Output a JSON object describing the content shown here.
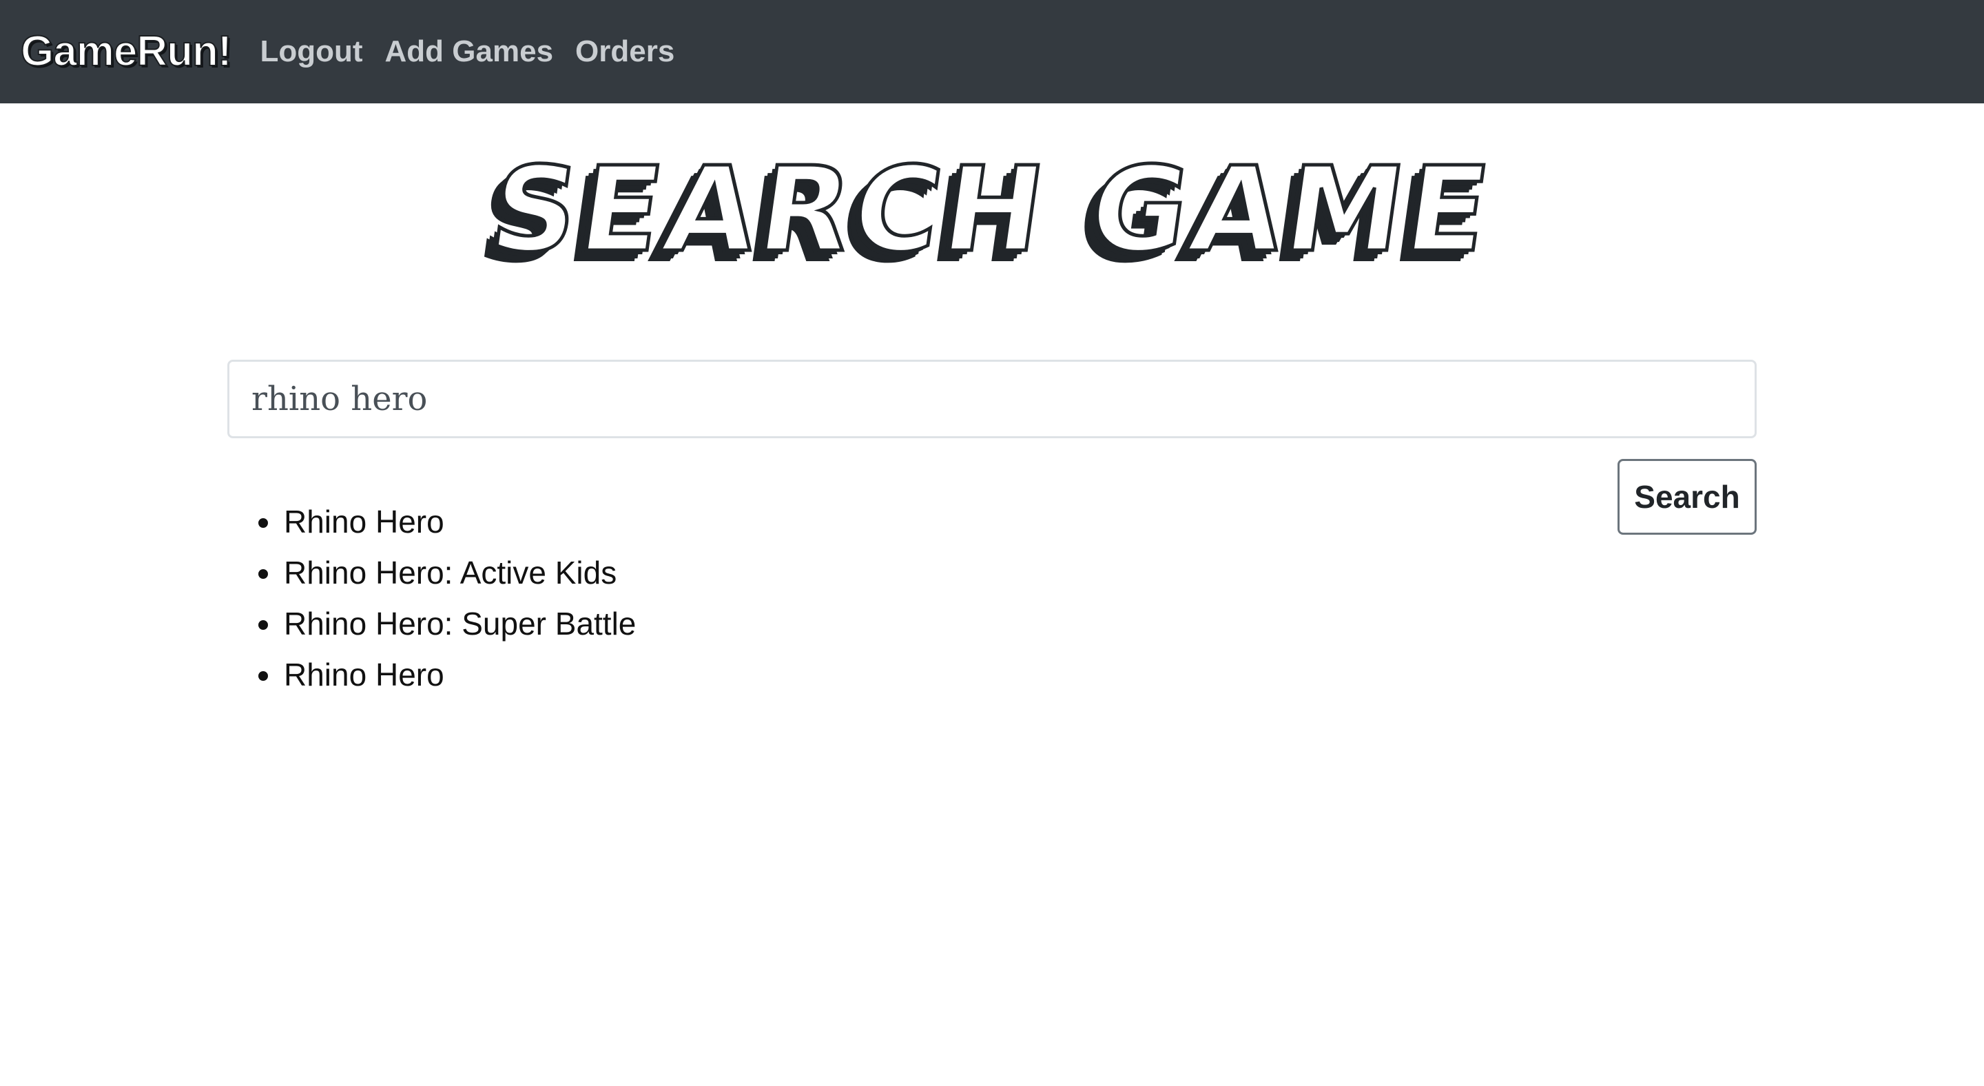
{
  "navbar": {
    "brand": "GameRun!",
    "links": [
      "Logout",
      "Add Games",
      "Orders"
    ]
  },
  "page": {
    "title": "SEARCH GAME"
  },
  "search": {
    "value": "rhino hero",
    "button_label": "Search"
  },
  "results": [
    "Rhino Hero",
    "Rhino Hero: Active Kids",
    "Rhino Hero: Super Battle",
    "Rhino Hero"
  ],
  "colors": {
    "navbar_bg": "#343a40",
    "nav_link": "#c9cdd1",
    "text": "#212529"
  }
}
